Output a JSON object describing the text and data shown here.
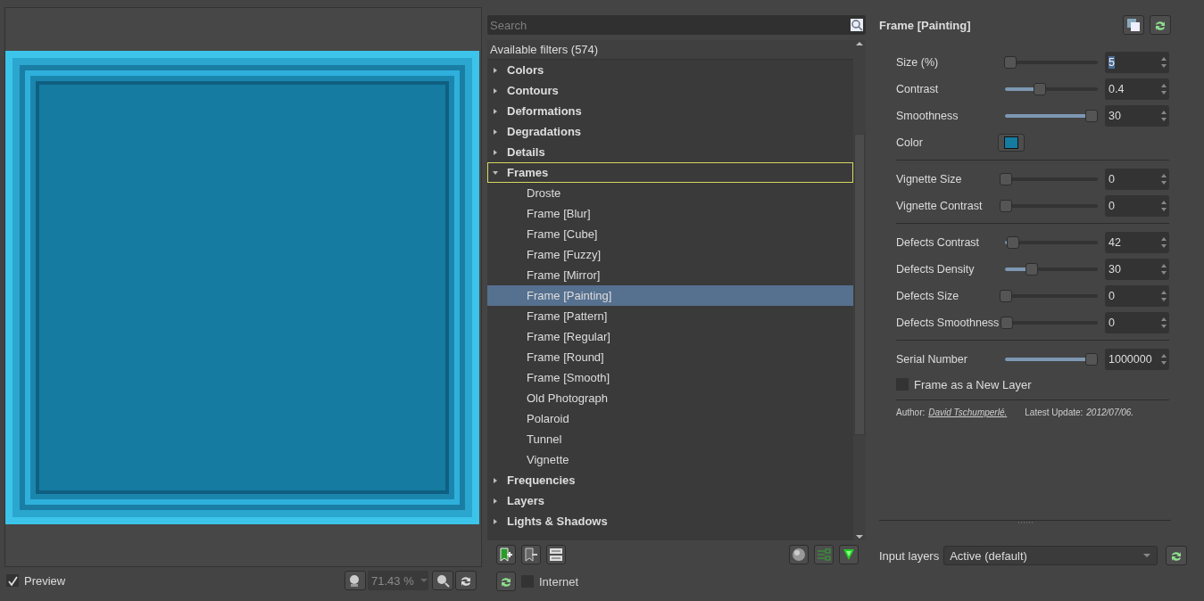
{
  "preview": {
    "kind": "picture",
    "checkbox": {
      "label": "Preview",
      "checked": true
    },
    "zoom": "71.43 %"
  },
  "filters": {
    "search": {
      "placeholder": "Search"
    },
    "header": "Available filters (574)",
    "tree": [
      {
        "label": "Colors",
        "expanded": false,
        "selected": false
      },
      {
        "label": "Contours",
        "expanded": false,
        "selected": false
      },
      {
        "label": "Deformations",
        "expanded": false,
        "selected": false
      },
      {
        "label": "Degradations",
        "expanded": false,
        "selected": false
      },
      {
        "label": "Details",
        "expanded": false,
        "selected": false
      },
      {
        "label": "Frames",
        "expanded": true,
        "selected": false,
        "focused": true,
        "children": [
          {
            "label": "Droste",
            "selected": false
          },
          {
            "label": "Frame [Blur]",
            "selected": false
          },
          {
            "label": "Frame [Cube]",
            "selected": false
          },
          {
            "label": "Frame [Fuzzy]",
            "selected": false
          },
          {
            "label": "Frame [Mirror]",
            "selected": false
          },
          {
            "label": "Frame [Painting]",
            "selected": true
          },
          {
            "label": "Frame [Pattern]",
            "selected": false
          },
          {
            "label": "Frame [Regular]",
            "selected": false
          },
          {
            "label": "Frame [Round]",
            "selected": false
          },
          {
            "label": "Frame [Smooth]",
            "selected": false
          },
          {
            "label": "Old Photograph",
            "selected": false
          },
          {
            "label": "Polaroid",
            "selected": false
          },
          {
            "label": "Tunnel",
            "selected": false
          },
          {
            "label": "Vignette",
            "selected": false
          }
        ]
      },
      {
        "label": "Frequencies",
        "expanded": false,
        "selected": false
      },
      {
        "label": "Layers",
        "expanded": false,
        "selected": false
      },
      {
        "label": "Lights & Shadows",
        "expanded": false,
        "selected": false
      }
    ],
    "internet": {
      "label": "Internet",
      "checked": false
    }
  },
  "params": {
    "title": "Frame [Painting]",
    "items": [
      {
        "kind": "slider",
        "label": "Size (%)",
        "level": 0.05,
        "value": "5",
        "highlighted": true
      },
      {
        "kind": "slider",
        "label": "Contrast",
        "level": 0.4,
        "value": "0.4",
        "highlighted": false
      },
      {
        "kind": "slider",
        "label": "Smoothness",
        "level": 1,
        "value": "30",
        "highlighted": false
      },
      {
        "kind": "color",
        "label": "Color",
        "color": "#157ba0"
      },
      {
        "kind": "separator"
      },
      {
        "kind": "slider",
        "label": "Vignette Size",
        "level": 0,
        "value": "0",
        "highlighted": false
      },
      {
        "kind": "slider",
        "label": "Vignette Contrast",
        "level": 0,
        "value": "0",
        "highlighted": false
      },
      {
        "kind": "separator"
      },
      {
        "kind": "slider",
        "label": "Defects Contrast",
        "level": 0.08,
        "value": "42",
        "highlighted": false
      },
      {
        "kind": "slider",
        "label": "Defects Density",
        "level": 0.3,
        "value": "30",
        "highlighted": false
      },
      {
        "kind": "slider",
        "label": "Defects Size",
        "level": 0,
        "value": "0",
        "highlighted": false
      },
      {
        "kind": "slider",
        "label": "Defects Smoothness",
        "level": 0,
        "value": "0",
        "highlighted": false
      },
      {
        "kind": "separator"
      },
      {
        "kind": "slider",
        "label": "Serial Number",
        "level": 1,
        "value": "1000000",
        "highlighted": false
      },
      {
        "kind": "checkbox",
        "label": "Frame as a New Layer",
        "checked": false
      },
      {
        "kind": "separator"
      }
    ],
    "author_label": "Author:",
    "author": "David Tschumperlé.",
    "update_label": "Latest Update:",
    "update": "2012/07/06.",
    "input_layers": {
      "label": "Input layers",
      "value": "Active (default)"
    }
  }
}
